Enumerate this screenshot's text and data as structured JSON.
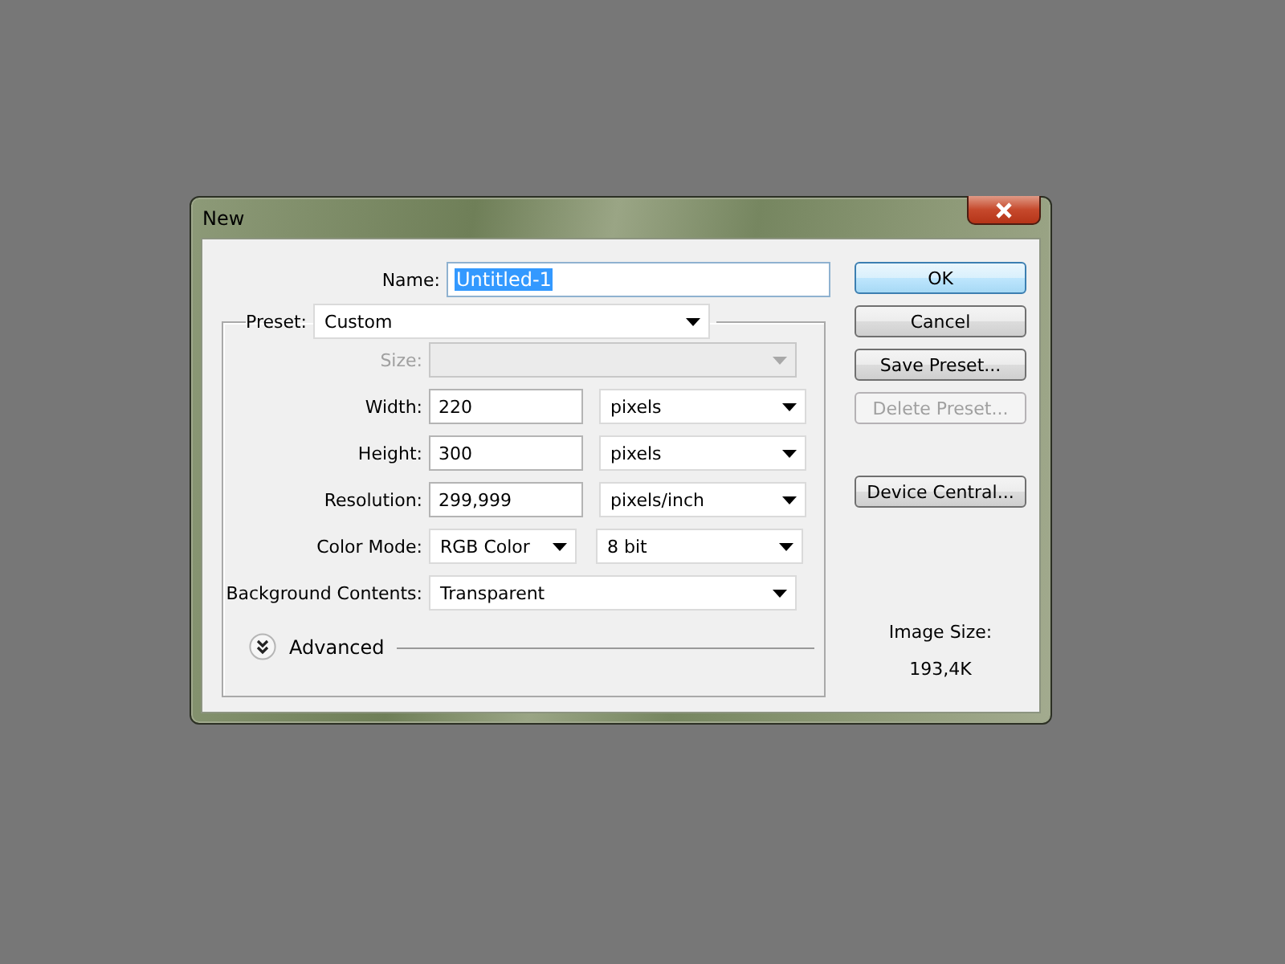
{
  "window": {
    "title": "New"
  },
  "name_field": {
    "label": "Name:",
    "value": "Untitled-1",
    "selected": true
  },
  "preset": {
    "label": "Preset:",
    "value": "Custom"
  },
  "rows": [
    {
      "kind": "select",
      "label": "Size:",
      "disabled": true
    },
    {
      "kind": "input_unit",
      "label": "Width:",
      "value": "220",
      "unit": "pixels",
      "disabled": false
    },
    {
      "kind": "input_unit",
      "label": "Height:",
      "value": "300",
      "unit": "pixels",
      "disabled": false
    },
    {
      "kind": "input_unit",
      "label": "Resolution:",
      "value": "299,999",
      "unit": "pixels/inch",
      "disabled": false
    },
    {
      "kind": "select_pair",
      "label": "Color Mode:",
      "value": "RGB Color",
      "unit": "8 bit",
      "disabled": false
    },
    {
      "kind": "select",
      "label": "Background Contents:",
      "value": "Transparent",
      "disabled": false
    }
  ],
  "advanced": {
    "label": "Advanced",
    "expanded": false
  },
  "buttons": [
    {
      "label": "OK",
      "default": true,
      "disabled": false
    },
    {
      "label": "Cancel",
      "default": false,
      "disabled": false
    },
    {
      "label": "Save Preset...",
      "default": false,
      "disabled": false
    },
    {
      "label": "Delete Preset...",
      "default": false,
      "disabled": true
    }
  ],
  "extra_buttons": [
    {
      "label": "Device Central...",
      "default": false,
      "disabled": false
    }
  ],
  "image_size": {
    "label": "Image Size:",
    "value": "193,4K"
  }
}
